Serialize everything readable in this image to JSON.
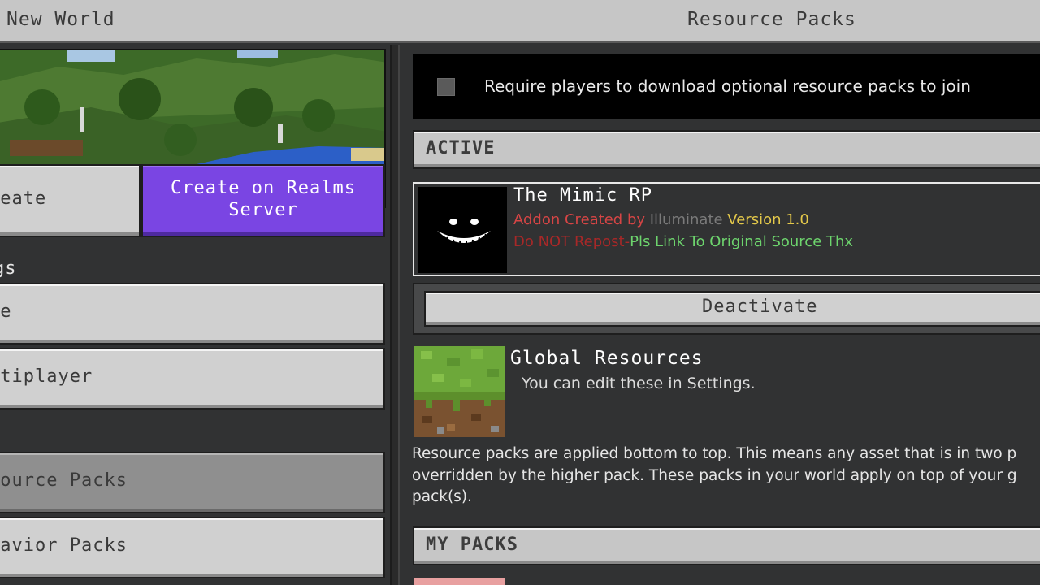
{
  "topbar": {
    "left_title": "New World",
    "right_title": "Resource Packs"
  },
  "left": {
    "create_label": "reate",
    "realms_label": "Create on Realms Server",
    "settings_heading": "gs",
    "game_label": "me",
    "multiplayer_label": "ltiplayer",
    "resource_packs_label": "source Packs",
    "behavior_packs_label": "havior Packs"
  },
  "right": {
    "require_text": "Require players to download optional resource packs to join",
    "active_header": "ACTIVE",
    "pack": {
      "name": "The Mimic RP",
      "line1_a": "Addon Created by ",
      "line1_b": "Illuminate",
      "line1_c": " Version 1.0",
      "line2_a": "Do NOT Repost-",
      "line2_b": "Pls Link To Original Source Thx"
    },
    "deactivate_label": "Deactivate",
    "global_title": "Global Resources",
    "global_sub": "You can edit these in Settings.",
    "info_text": "Resource packs are applied bottom to top. This means any asset that is in two p overridden by the higher pack. These packs in your world apply on top of your g pack(s).",
    "mypacks_header": "MY PACKS"
  },
  "colors": {
    "realms_purple": "#7a45e3",
    "panel_bg": "#313233",
    "button_gray": "#d0d0d0",
    "selected_gray": "#8f8f8f"
  }
}
